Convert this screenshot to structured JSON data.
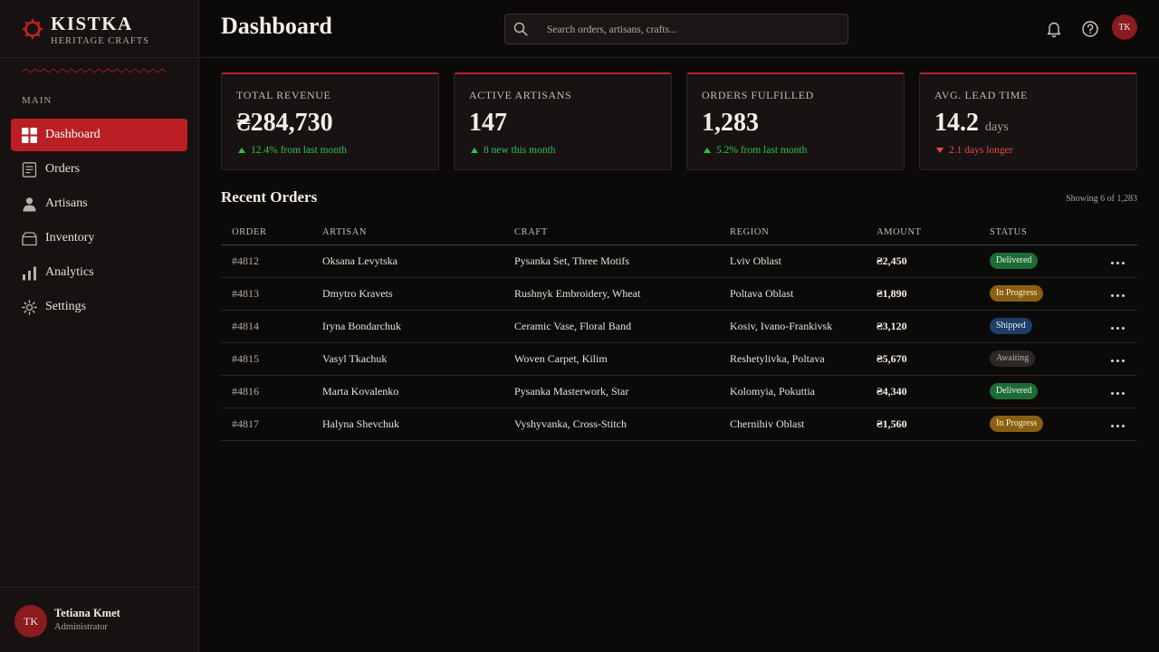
{
  "brand": {
    "name": "KISTKA",
    "subtitle": "HERITAGE CRAFTS",
    "accent": "#b91f24"
  },
  "sidebar": {
    "section_label": "MAIN",
    "items": [
      {
        "label": "Dashboard",
        "icon": "dashboard-grid-icon",
        "active": true
      },
      {
        "label": "Orders",
        "icon": "orders-document-icon"
      },
      {
        "label": "Artisans",
        "icon": "person-icon"
      },
      {
        "label": "Inventory",
        "icon": "box-icon"
      },
      {
        "label": "Analytics",
        "icon": "bar-chart-icon"
      },
      {
        "label": "Settings",
        "icon": "gear-icon"
      }
    ],
    "user": {
      "initials": "TK",
      "name": "Tetiana Kmet",
      "role": "Administrator"
    }
  },
  "header": {
    "title": "Dashboard",
    "search_placeholder": "Search orders, artisans, crafts...",
    "avatar_initials": "TK"
  },
  "kpis": [
    {
      "label": "TOTAL REVENUE",
      "value": "₴284,730",
      "unit": "",
      "trend": "12.4% from last month",
      "direction": "up"
    },
    {
      "label": "ACTIVE ARTISANS",
      "value": "147",
      "unit": "",
      "trend": "8 new this month",
      "direction": "up"
    },
    {
      "label": "ORDERS FULFILLED",
      "value": "1,283",
      "unit": "",
      "trend": "5.2% from last month",
      "direction": "up"
    },
    {
      "label": "AVG. LEAD TIME",
      "value": "14.2",
      "unit": "days",
      "trend": "2.1 days longer",
      "direction": "down"
    }
  ],
  "orders": {
    "title": "Recent Orders",
    "showing": "Showing 6 of 1,283",
    "columns": [
      "ORDER",
      "ARTISAN",
      "CRAFT",
      "REGION",
      "AMOUNT",
      "STATUS"
    ],
    "rows": [
      {
        "order": "#4812",
        "artisan": "Oksana Levytska",
        "craft": "Pysanka Set, Three Motifs",
        "region": "Lviv Oblast",
        "amount": "₴2,450",
        "status": "Delivered"
      },
      {
        "order": "#4813",
        "artisan": "Dmytro Kravets",
        "craft": "Rushnyk Embroidery, Wheat",
        "region": "Poltava Oblast",
        "amount": "₴1,890",
        "status": "In Progress"
      },
      {
        "order": "#4814",
        "artisan": "Iryna Bondarchuk",
        "craft": "Ceramic Vase, Floral Band",
        "region": "Kosiv, Ivano-Frankivsk",
        "amount": "₴3,120",
        "status": "Shipped"
      },
      {
        "order": "#4815",
        "artisan": "Vasyl Tkachuk",
        "craft": "Woven Carpet, Kilim",
        "region": "Reshetylivka, Poltava",
        "amount": "₴5,670",
        "status": "Awaiting"
      },
      {
        "order": "#4816",
        "artisan": "Marta Kovalenko",
        "craft": "Pysanka Masterwork, Star",
        "region": "Kolomyia, Pokuttia",
        "amount": "₴4,340",
        "status": "Delivered"
      },
      {
        "order": "#4817",
        "artisan": "Halyna Shevchuk",
        "craft": "Vyshyvanka, Cross-Stitch",
        "region": "Chernihiv Oblast",
        "amount": "₴1,560",
        "status": "In Progress"
      }
    ],
    "status_colors": {
      "Delivered": {
        "bg": "#1d6b35",
        "fg": "#e6f6ea"
      },
      "In Progress": {
        "bg": "#8a6010",
        "fg": "#fbefd2"
      },
      "Shipped": {
        "bg": "#1f3d66",
        "fg": "#e2ecfb"
      },
      "Awaiting": {
        "bg": "#2c2827",
        "fg": "#b8b0aa"
      }
    }
  }
}
